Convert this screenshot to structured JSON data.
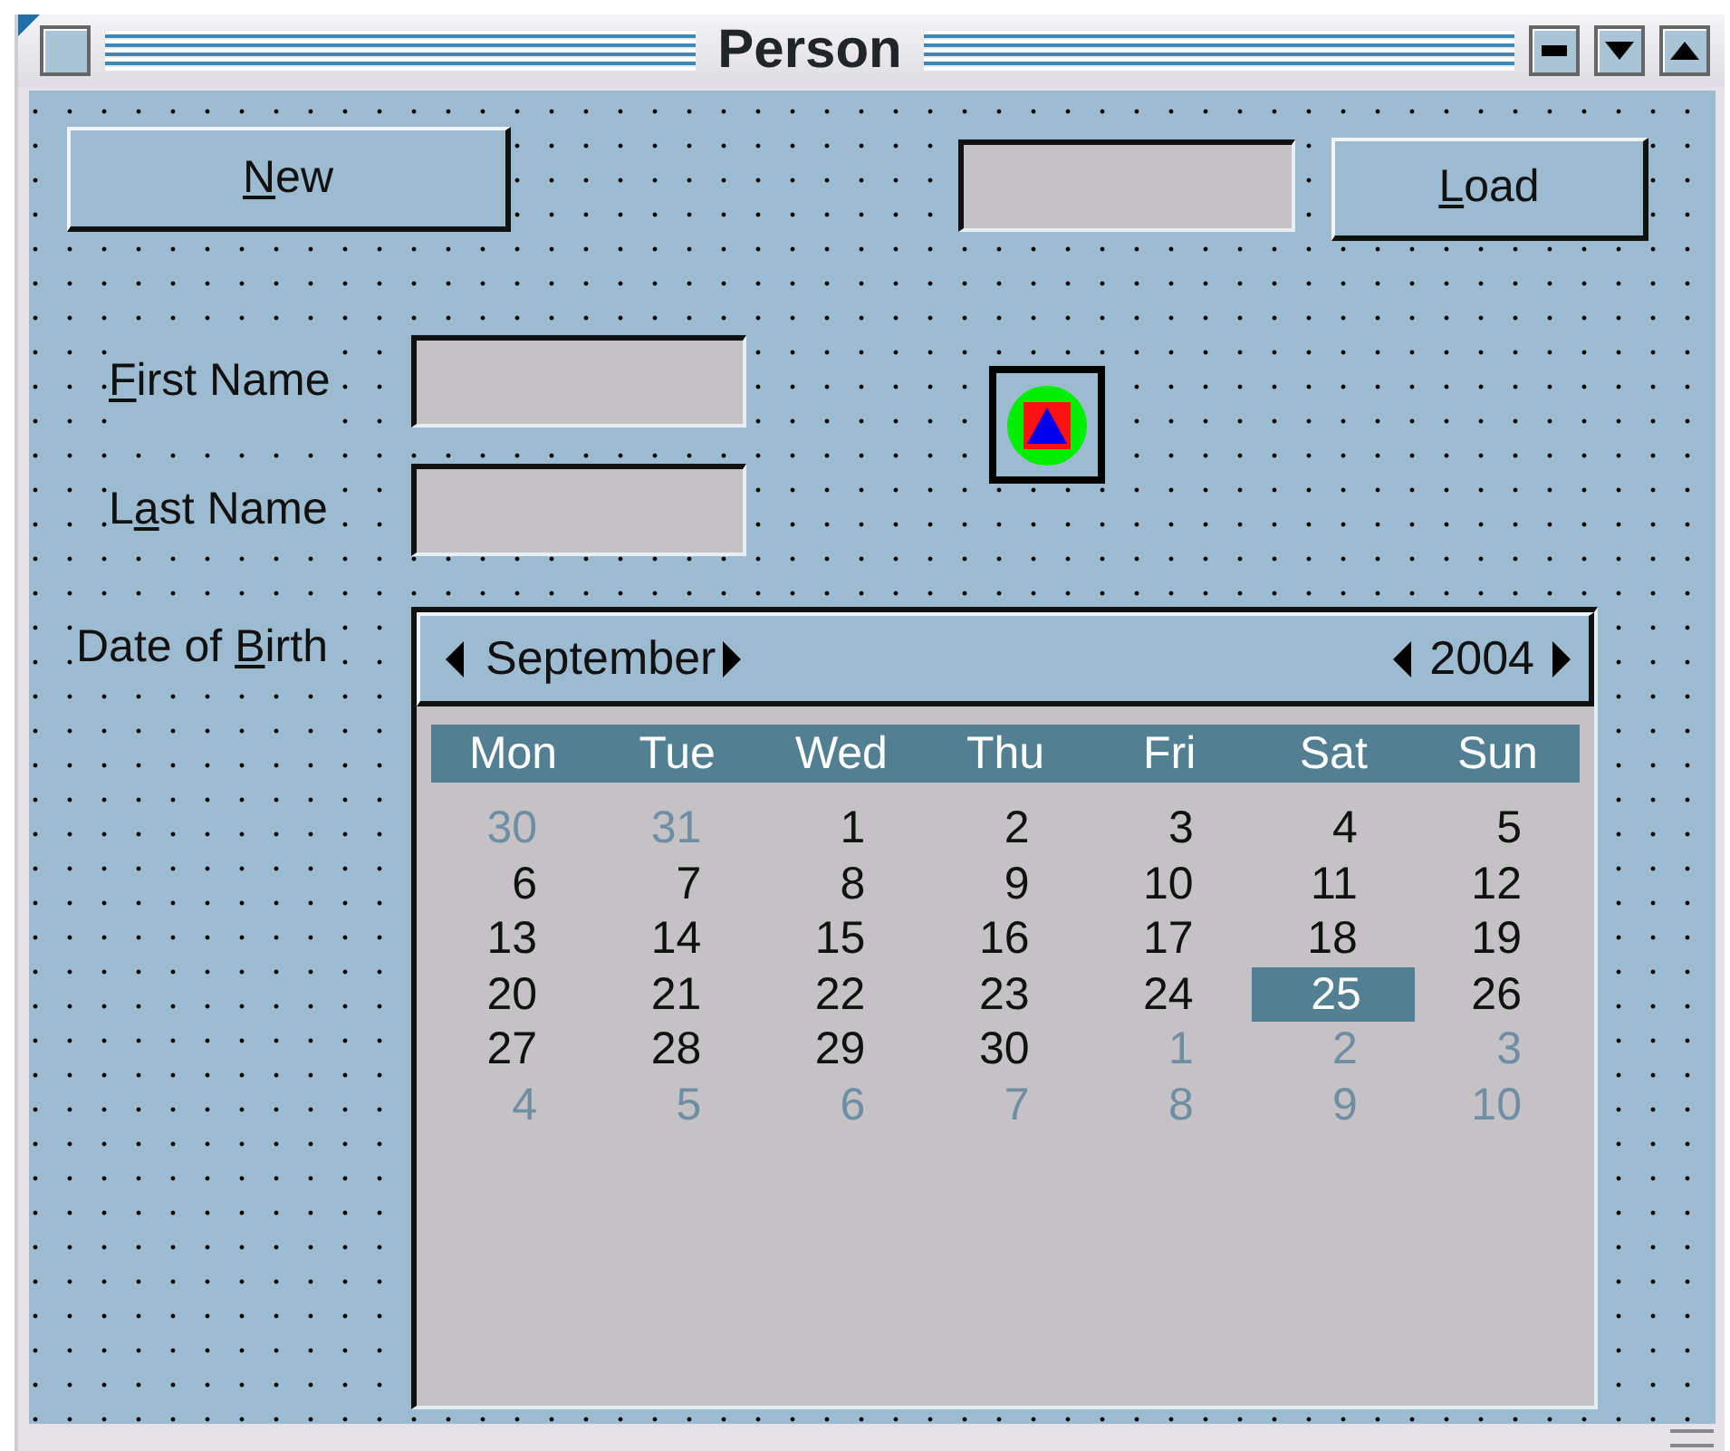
{
  "window": {
    "title": "Person"
  },
  "buttons": [
    {
      "kind": "new",
      "label": {
        "key": "N",
        "post": "ew"
      }
    },
    {
      "kind": "load",
      "label": {
        "key": "L",
        "post": "oad"
      }
    }
  ],
  "fields": [
    {
      "kind": "label",
      "label": {
        "key": "F",
        "post": "irst Name"
      }
    },
    {
      "kind": "label",
      "label": {
        "pre": "L",
        "key": "a",
        "post": "st Name"
      }
    },
    {
      "kind": "label",
      "label": {
        "pre": "Date of ",
        "key": "B",
        "post": "irth"
      }
    }
  ],
  "calendar": {
    "month": "September",
    "year": "2004",
    "weekdays": [
      "Mon",
      "Tue",
      "Wed",
      "Thu",
      "Fri",
      "Sat",
      "Sun"
    ],
    "weeks": [
      [
        {
          "day": "30",
          "outside": true,
          "selected": false
        },
        {
          "day": "31",
          "outside": true,
          "selected": false
        },
        {
          "day": "1",
          "outside": false,
          "selected": false
        },
        {
          "day": "2",
          "outside": false,
          "selected": false
        },
        {
          "day": "3",
          "outside": false,
          "selected": false
        },
        {
          "day": "4",
          "outside": false,
          "selected": false
        },
        {
          "day": "5",
          "outside": false,
          "selected": false
        }
      ],
      [
        {
          "day": "6",
          "outside": false,
          "selected": false
        },
        {
          "day": "7",
          "outside": false,
          "selected": false
        },
        {
          "day": "8",
          "outside": false,
          "selected": false
        },
        {
          "day": "9",
          "outside": false,
          "selected": false
        },
        {
          "day": "10",
          "outside": false,
          "selected": false
        },
        {
          "day": "11",
          "outside": false,
          "selected": false
        },
        {
          "day": "12",
          "outside": false,
          "selected": false
        }
      ],
      [
        {
          "day": "13",
          "outside": false,
          "selected": false
        },
        {
          "day": "14",
          "outside": false,
          "selected": false
        },
        {
          "day": "15",
          "outside": false,
          "selected": false
        },
        {
          "day": "16",
          "outside": false,
          "selected": false
        },
        {
          "day": "17",
          "outside": false,
          "selected": false
        },
        {
          "day": "18",
          "outside": false,
          "selected": false
        },
        {
          "day": "19",
          "outside": false,
          "selected": false
        }
      ],
      [
        {
          "day": "20",
          "outside": false,
          "selected": false
        },
        {
          "day": "21",
          "outside": false,
          "selected": false
        },
        {
          "day": "22",
          "outside": false,
          "selected": false
        },
        {
          "day": "23",
          "outside": false,
          "selected": false
        },
        {
          "day": "24",
          "outside": false,
          "selected": false
        },
        {
          "day": "25",
          "outside": false,
          "selected": true
        },
        {
          "day": "26",
          "outside": false,
          "selected": false
        }
      ],
      [
        {
          "day": "27",
          "outside": false,
          "selected": false
        },
        {
          "day": "28",
          "outside": false,
          "selected": false
        },
        {
          "day": "29",
          "outside": false,
          "selected": false
        },
        {
          "day": "30",
          "outside": false,
          "selected": false
        },
        {
          "day": "1",
          "outside": true,
          "selected": false
        },
        {
          "day": "2",
          "outside": true,
          "selected": false
        },
        {
          "day": "3",
          "outside": true,
          "selected": false
        }
      ],
      [
        {
          "day": "4",
          "outside": true,
          "selected": false
        },
        {
          "day": "5",
          "outside": true,
          "selected": false
        },
        {
          "day": "6",
          "outside": true,
          "selected": false
        },
        {
          "day": "7",
          "outside": true,
          "selected": false
        },
        {
          "day": "8",
          "outside": true,
          "selected": false
        },
        {
          "day": "9",
          "outside": true,
          "selected": false
        },
        {
          "day": "10",
          "outside": true,
          "selected": false
        }
      ]
    ]
  }
}
